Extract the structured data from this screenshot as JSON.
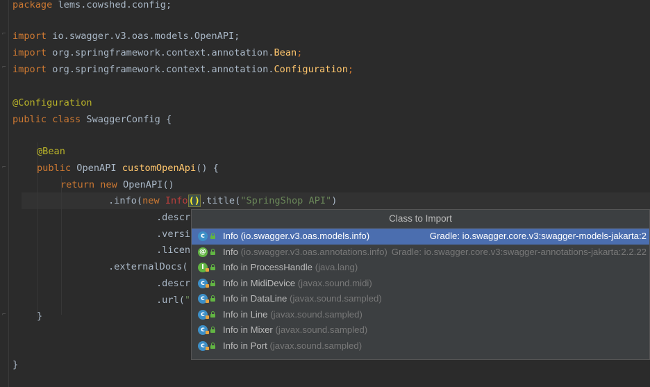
{
  "code": {
    "line1": {
      "kw": "package",
      "rest": " lems.cowshed.config;"
    },
    "line3": {
      "kw": "import",
      "rest": " io.swagger.v3.oas.models.OpenAPI;"
    },
    "line4": {
      "kw": "import",
      "rest": " org.springframework.context.annotation.",
      "cls": "Bean",
      ";": ";"
    },
    "line5": {
      "kw": "import",
      "rest": " org.springframework.context.annotation.",
      "cls": "Configuration",
      "end": ";"
    },
    "line7": {
      "ann": "@Configuration"
    },
    "line8": {
      "kw": "public class",
      "name": " SwaggerConfig ",
      "brace": "{"
    },
    "line10": {
      "ann": "@Bean"
    },
    "line11": {
      "kw": "public",
      "type": " OpenAPI ",
      "method": "customOpenApi",
      "rest": "() {"
    },
    "line12": {
      "kw": "return new",
      "rest": " OpenAPI()"
    },
    "line13": {
      "pre": ".info(",
      "kw": "new ",
      "err": "Info",
      "caret": "()",
      "post": ".title(",
      "str": "\"SpringShop API\"",
      "close": ")"
    },
    "line14": {
      "text": ".descr"
    },
    "line15": {
      "text": ".versi"
    },
    "line16": {
      "text": ".licen"
    },
    "line17": {
      "text": ".externalDocs("
    },
    "line18": {
      "text": ".descr"
    },
    "line19": {
      "pre": ".url(",
      "str": "\""
    },
    "line20": {
      "text": "}"
    },
    "line23": {
      "text": "}"
    }
  },
  "popup": {
    "title": "Class to Import",
    "items": [
      {
        "name": "Info",
        "pkg": " (io.swagger.v3.oas.models.info)",
        "src": "Gradle: io.swagger.core.v3:swagger-models-jakarta:2",
        "icon": "class-icon",
        "selected": true
      },
      {
        "name": "Info",
        "pkg": " (io.swagger.v3.oas.annotations.info)",
        "src": "Gradle: io.swagger.core.v3:swagger-annotations-jakarta:2.2.22",
        "icon": "annotation-icon",
        "selected": false
      },
      {
        "name": "Info in ProcessHandle",
        "pkg": " (java.lang)",
        "src": "",
        "icon": "interface-icon",
        "selected": false
      },
      {
        "name": "Info in MidiDevice",
        "pkg": " (javax.sound.midi)",
        "src": "",
        "icon": "class-icon",
        "selected": false
      },
      {
        "name": "Info in DataLine",
        "pkg": " (javax.sound.sampled)",
        "src": "",
        "icon": "class-icon",
        "selected": false
      },
      {
        "name": "Info in Line",
        "pkg": " (javax.sound.sampled)",
        "src": "",
        "icon": "class-icon",
        "selected": false
      },
      {
        "name": "Info in Mixer",
        "pkg": " (javax.sound.sampled)",
        "src": "",
        "icon": "class-icon",
        "selected": false
      },
      {
        "name": "Info in Port",
        "pkg": " (javax.sound.sampled)",
        "src": "",
        "icon": "class-icon",
        "selected": false
      }
    ]
  },
  "colors": {
    "background": "#2b2b2b",
    "keyword": "#cc7832",
    "annotation": "#bbb529",
    "string": "#6a8759",
    "selection": "#4b6eaf"
  }
}
